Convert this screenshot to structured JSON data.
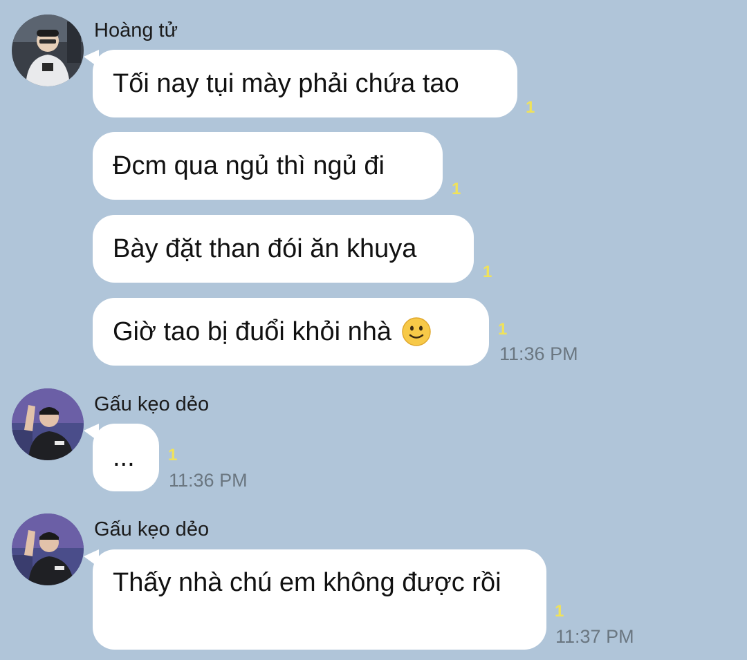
{
  "messages": [
    {
      "sender": "Hoàng tử",
      "avatar": "gamer-avatar-icon",
      "items": [
        {
          "text": "Tối nay tụi mày phải chứa tao",
          "read": "1",
          "time": ""
        },
        {
          "text": "Đcm qua ngủ thì ngủ đi",
          "read": "1",
          "time": ""
        },
        {
          "text": "Bày đặt than đói ăn khuya",
          "read": "1",
          "time": ""
        },
        {
          "text": "Giờ tao bị đuổi khỏi nhà",
          "emoji": "slightly-smiling-face-icon",
          "read": "1",
          "time": "11:36 PM"
        }
      ]
    },
    {
      "sender": "Gấu kẹo dẻo",
      "avatar": "player-avatar-icon",
      "items": [
        {
          "text": "...",
          "read": "1",
          "time": "11:36 PM"
        }
      ]
    },
    {
      "sender": "Gấu kẹo dẻo",
      "avatar": "player-avatar-icon",
      "items": [
        {
          "text": "Thấy nhà chú em không được rồi",
          "read": "1",
          "time": "11:37 PM"
        }
      ]
    }
  ],
  "colors": {
    "background": "#b0c5d9",
    "bubble": "#ffffff",
    "read_indicator": "#f0e25a",
    "timestamp": "#6a7680"
  }
}
